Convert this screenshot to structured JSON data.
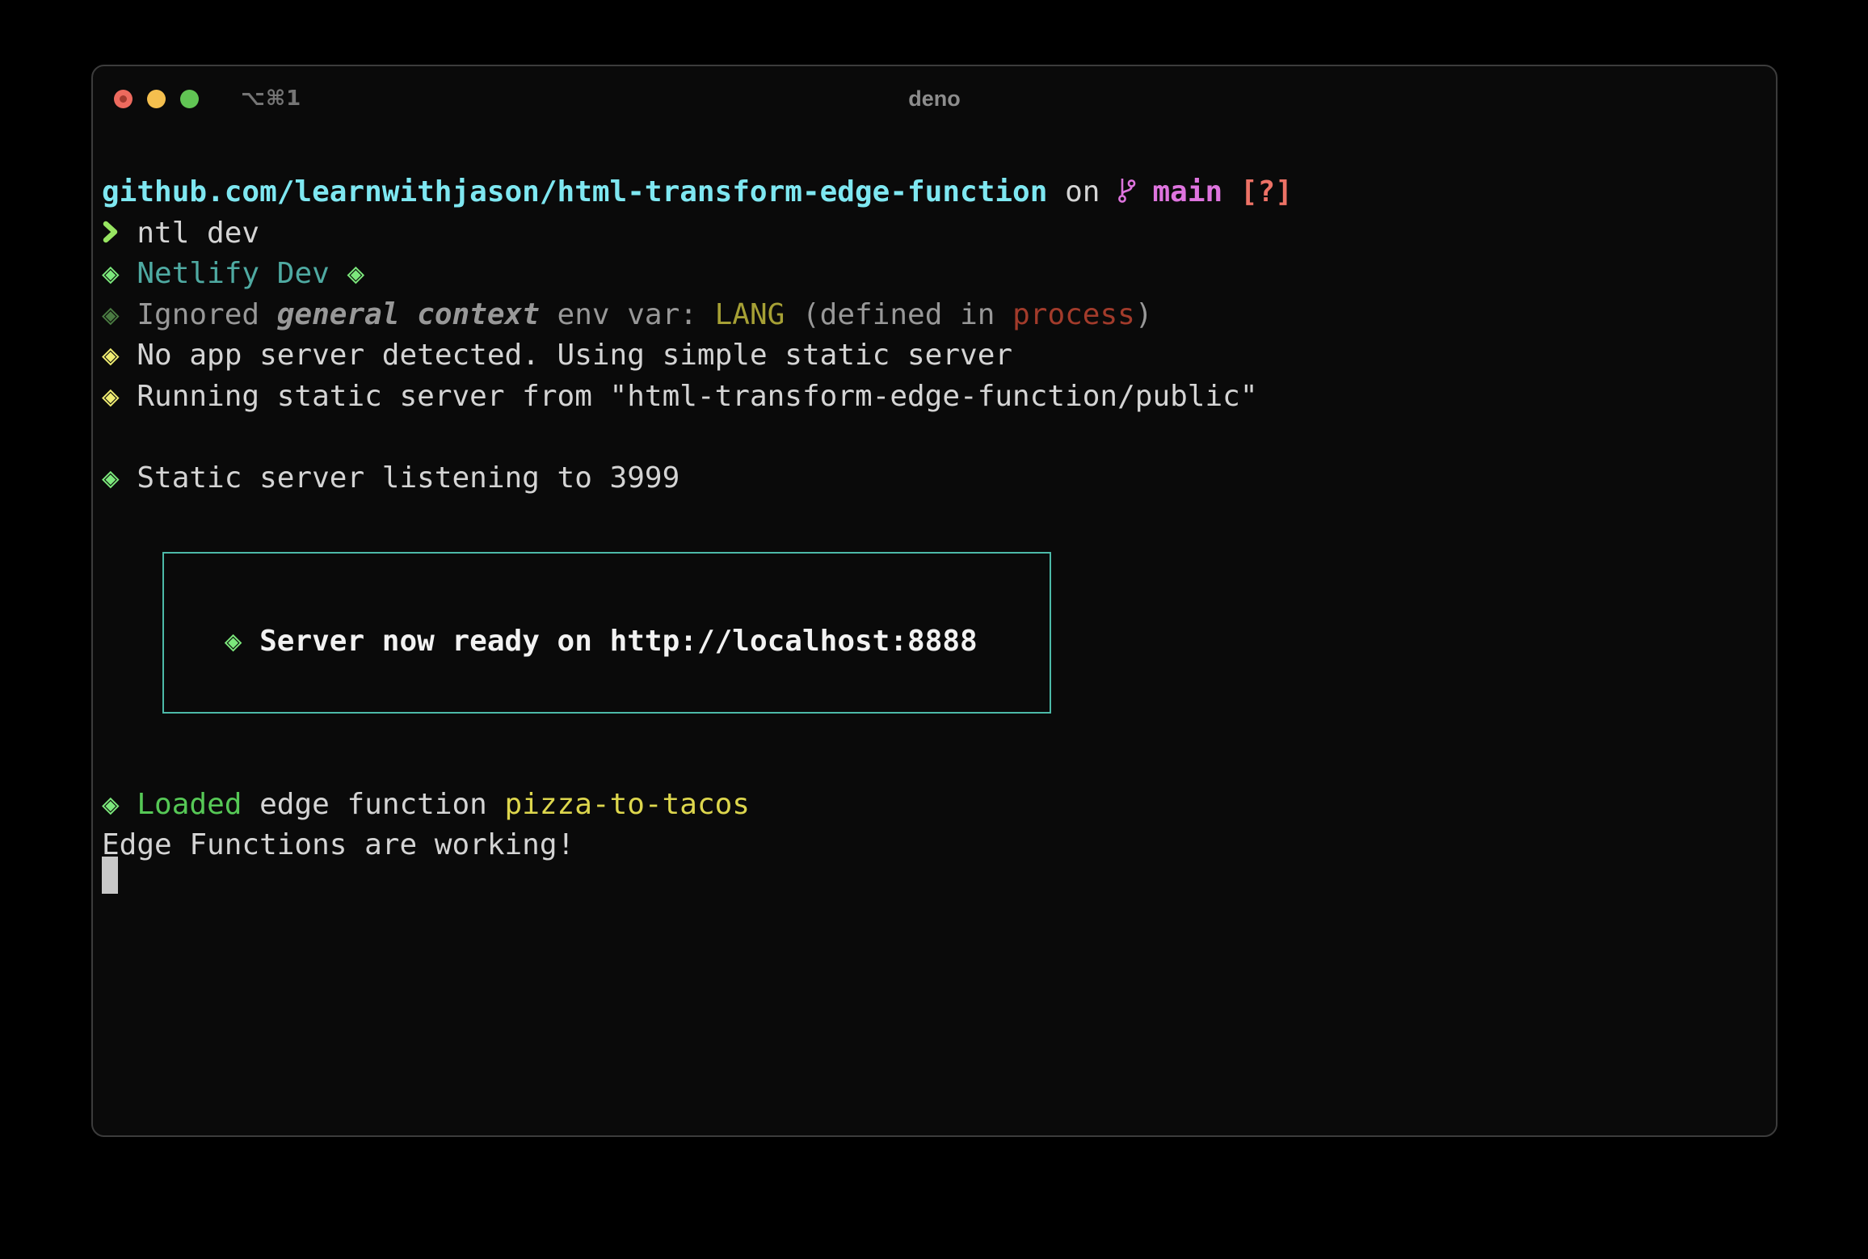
{
  "titlebar": {
    "shortcut": "⌥⌘1",
    "title": "deno",
    "lights": [
      "close",
      "minimize",
      "zoom"
    ]
  },
  "palette": {
    "window_bg": "#0a0a0a",
    "window_border": "#3c3c3c",
    "title_fg": "#8d8d8d",
    "shortcut_fg": "#757575",
    "light_red": "#ed6a5e",
    "light_red_dot": "#a33b30",
    "light_yellow": "#f4bf4e",
    "light_green": "#61c554",
    "fg": "#d4d4d4",
    "fg_bright": "#f2f2f2",
    "cyan": "#7ee7f1",
    "teal": "#4faaa2",
    "magenta": "#de74de",
    "salmon": "#ed7266",
    "prompt_green": "#97e561",
    "diamond_green": "#7ce87c",
    "dim_green": "#4a7b42",
    "diamond_yellow": "#efec72",
    "loaded_green": "#56c856",
    "text_yellow": "#ddd64d",
    "olive": "#a6a035",
    "brick": "#a23b2b",
    "gray": "#989898",
    "box_border": "#4cb9a8",
    "cursor": "#c8c8c8"
  },
  "terminal": {
    "rows": [
      {
        "row": 0,
        "segments": [
          {
            "t": "github.com/learnwithjason/html-transform-edge-function",
            "c": "cyan",
            "b": true
          },
          {
            "t": " on "
          },
          {
            "icon": "git-branch-icon",
            "c": "magenta"
          },
          {
            "t": " "
          },
          {
            "t": "main",
            "c": "magenta",
            "b": true
          },
          {
            "t": " "
          },
          {
            "t": "[?]",
            "c": "salmon",
            "b": true
          }
        ]
      },
      {
        "row": 1,
        "segments": [
          {
            "icon": "prompt-chevron-icon",
            "c": "prompt_green"
          },
          {
            "t": " ntl dev"
          }
        ]
      },
      {
        "row": 2,
        "segments": [
          {
            "t": "◈",
            "c": "diamond_green"
          },
          {
            "t": " "
          },
          {
            "t": "Netlify Dev",
            "c": "teal"
          },
          {
            "t": " "
          },
          {
            "t": "◈",
            "c": "diamond_green"
          }
        ]
      },
      {
        "row": 3,
        "segments": [
          {
            "t": "◈",
            "c": "dim_green"
          },
          {
            "t": " Ignored ",
            "c": "gray"
          },
          {
            "t": "general context",
            "c": "gray",
            "b": true,
            "i": true
          },
          {
            "t": " env var: ",
            "c": "gray"
          },
          {
            "t": "LANG",
            "c": "olive"
          },
          {
            "t": " (defined in ",
            "c": "gray"
          },
          {
            "t": "process",
            "c": "brick"
          },
          {
            "t": ")",
            "c": "gray"
          }
        ]
      },
      {
        "row": 4,
        "segments": [
          {
            "t": "◈",
            "c": "diamond_yellow"
          },
          {
            "t": " No app server detected. Using simple static server"
          }
        ]
      },
      {
        "row": 5,
        "segments": [
          {
            "t": "◈",
            "c": "diamond_yellow"
          },
          {
            "t": " Running static server from \"html-transform-edge-function/public\""
          }
        ]
      },
      {
        "row": 7,
        "segments": [
          {
            "t": "◈",
            "c": "diamond_green"
          },
          {
            "t": " Static server listening to 3999"
          }
        ]
      },
      {
        "row": 11,
        "segments": [
          {
            "t": "       "
          },
          {
            "t": "◈",
            "c": "diamond_green",
            "b": true
          },
          {
            "t": " ",
            "b": true
          },
          {
            "t": "Server now ready on http://localhost:8888",
            "c": "fg_bright",
            "b": true
          }
        ]
      },
      {
        "row": 15,
        "segments": [
          {
            "t": "◈",
            "c": "diamond_green"
          },
          {
            "t": " "
          },
          {
            "t": "Loaded",
            "c": "loaded_green"
          },
          {
            "t": " edge function "
          },
          {
            "t": "pizza-to-tacos",
            "c": "text_yellow"
          }
        ]
      },
      {
        "row": 16,
        "segments": [
          {
            "t": "Edge Functions are working!"
          }
        ]
      }
    ]
  }
}
